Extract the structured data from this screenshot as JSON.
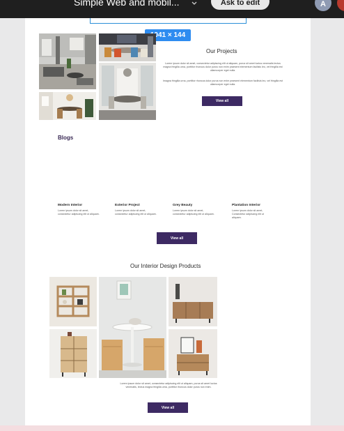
{
  "topbar": {
    "app_title": "Simple Web and mobil...",
    "ask_button": "Ask to edit",
    "avatar_letter": "A"
  },
  "selection": {
    "dimension_label": "1041 × 144"
  },
  "projects": {
    "title": "Our Projects",
    "paragraph1": "Lorem ipsum dolor sit amet, consectetur adipiscing elit ut aliquam, purus sit amet luctus venenatis lectus magna fringilla urna, porttitor rhoncus dolor purus non enim praesent elementum facilisis leo, vel fringilla est ullamcorper eget nulla.",
    "paragraph2": "Imagna fringilla urna, porttitor rhoncus dolor purus non enim praesent elementum facilisis leo, vel fringilla est ullamcorper eget nulla.",
    "button": "View all"
  },
  "blogs": {
    "title": "Blogs",
    "items": [
      {
        "title": "Modern Interior",
        "desc": "Lorem ipsum dolor sit amet, consectetur adipiscing elit ut aliquam."
      },
      {
        "title": "Exterior Project",
        "desc": "Lorem ipsum dolor sit amet, consectetur adipiscing elit ut aliquam."
      },
      {
        "title": "Grey Beauty",
        "desc": "Lorem ipsum dolor sit amet, consectetur adipiscing elit ut aliquam."
      },
      {
        "title": "Plantation Interior",
        "desc": "Lorem ipsum dolor sit amet, Consectetur adipiscing elit ut aliquam."
      }
    ],
    "button": "View all"
  },
  "products": {
    "title": "Our Interior Design Products",
    "paragraph": "Lorem ipsum dolor sit amet, consectetur adipiscing elit ut aliquam, purus sit amet luctus venenatis, lectus magna fringilla urna, porttitor rhoncus dolor purus non enim.",
    "button": "View all"
  },
  "colors": {
    "accent_button": "#3d2a63",
    "selection_blue": "#2e8cf0",
    "topbar": "#1f1f1f"
  }
}
